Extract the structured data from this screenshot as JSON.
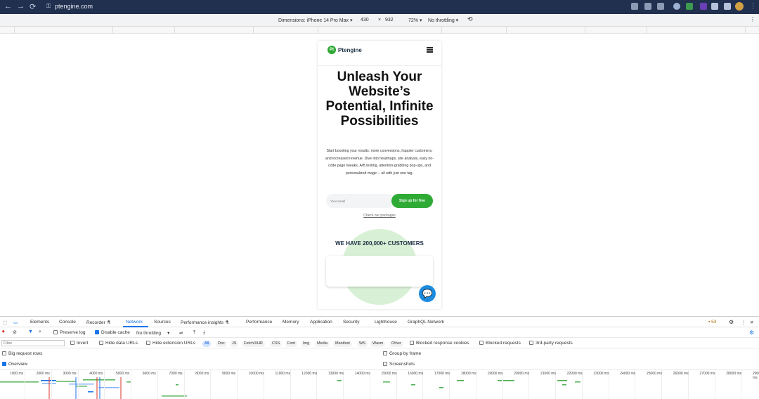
{
  "browser": {
    "url": "ptengine.com",
    "nav": {
      "back": "←",
      "forward": "→",
      "reload": "⟳"
    }
  },
  "device_toolbar": {
    "dimensions_label": "Dimensions: iPhone 14 Pro Max ▾",
    "width": "430",
    "times": "×",
    "height": "932",
    "zoom": "72% ▾",
    "throttling": "No throttling ▾"
  },
  "page": {
    "logo_text": "Ptengine",
    "logo_mark": "Pt",
    "hero_title": "Unleash Your Website’s Potential, Infinite Possibilities",
    "hero_desc": "Start boosting your results: more conversions, happier customers, and increased revenue. Dive into heatmaps, site analysis, easy no-code page tweaks, A/B testing, attention-grabbing pop-ups, and personalized magic – all with just one tag.",
    "email_placeholder": "Your email",
    "signup_label": "Sign up for free",
    "packages_link": "Check our packages",
    "customers_heading": "WE HAVE 200,000+ CUSTOMERS"
  },
  "devtools": {
    "tabs": [
      "Elements",
      "Console",
      "Recorder ⚗",
      "Network",
      "Sources",
      "Performance insights ⚗",
      "Performance",
      "Memory",
      "Application",
      "Security",
      "Lighthouse",
      "GraphQL Network"
    ],
    "active_tab": "Network",
    "issues_count": "53",
    "toolbar": {
      "preserve_log": "Preserve log",
      "disable_cache": "Disable cache",
      "throttling": "No throttling"
    },
    "filter_placeholder": "Filter",
    "filters": {
      "invert": "Invert",
      "hide_data_urls": "Hide data URLs",
      "hide_extension_urls": "Hide extension URLs",
      "types": [
        "All",
        "Doc",
        "JS",
        "Fetch/XHR",
        "CSS",
        "Font",
        "Img",
        "Media",
        "Manifest",
        "WS",
        "Wasm",
        "Other"
      ],
      "blocked_response_cookies": "Blocked response cookies",
      "blocked_requests": "Blocked requests",
      "third_party": "3rd-party requests"
    },
    "options": {
      "big_request_rows": "Big request rows",
      "overview": "Overview",
      "group_by_frame": "Group by frame",
      "screenshots": "Screenshots"
    },
    "timeline_ticks": [
      "1000 ms",
      "2000 ms",
      "3000 ms",
      "4000 ms",
      "5000 ms",
      "6000 ms",
      "7000 ms",
      "8000 ms",
      "9000 ms",
      "10000 ms",
      "11000 ms",
      "12000 ms",
      "13000 ms",
      "14000 ms",
      "15000 ms",
      "16000 ms",
      "17000 ms",
      "18000 ms",
      "19000 ms",
      "20000 ms",
      "21000 ms",
      "22000 ms",
      "23000 ms",
      "24000 ms",
      "25000 ms",
      "26000 ms",
      "27000 ms",
      "28000 ms",
      "29000 ms"
    ]
  },
  "colors": {
    "brand_green": "#2eaa35",
    "browser_bar": "#21304f",
    "devtools_accent": "#1a73e8",
    "chat_blue": "#1d8bde"
  }
}
